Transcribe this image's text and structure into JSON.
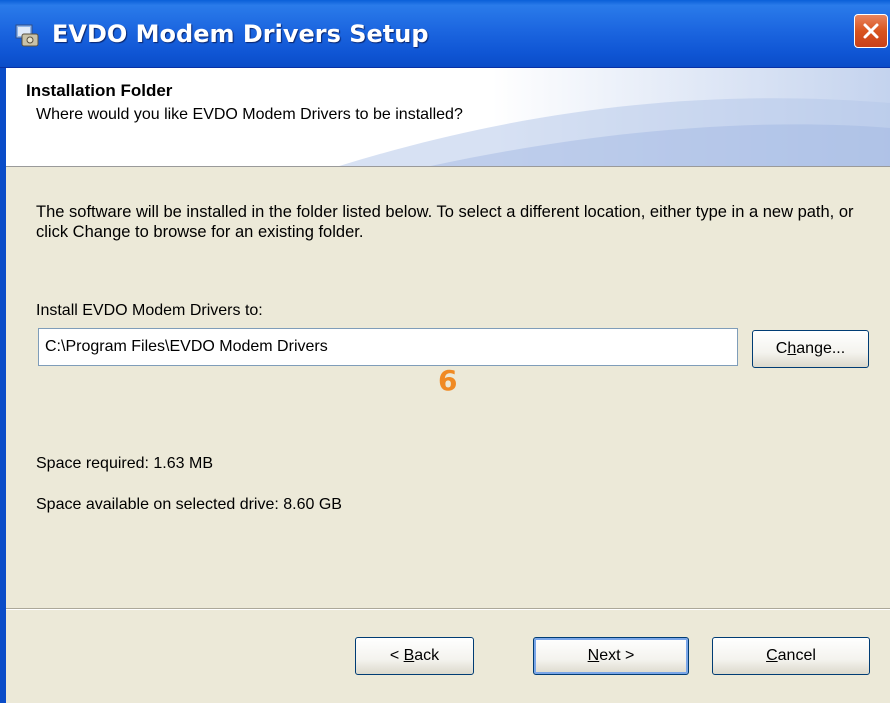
{
  "window": {
    "title": "EVDO Modem Drivers Setup",
    "icon": "setup-app-icon",
    "close_icon": "close-x-icon"
  },
  "header": {
    "title": "Installation Folder",
    "subtitle": "Where would you like EVDO Modem Drivers to be installed?"
  },
  "body": {
    "description": "The software will be installed in the folder listed below. To select a different location, either type in a new path, or click Change to browse for an existing folder.",
    "install_label": "Install EVDO Modem Drivers to:",
    "install_path": "C:\\Program Files\\EVDO Modem Drivers",
    "change_button": {
      "prefix": "C",
      "accel": "h",
      "suffix": "ange..."
    },
    "step_marker": "6",
    "space_required": "Space required: 1.63 MB",
    "space_available": "Space available on selected drive: 8.60 GB"
  },
  "footer": {
    "back_button": {
      "prefix": "< ",
      "accel": "B",
      "suffix": "ack"
    },
    "next_button": {
      "prefix": "",
      "accel": "N",
      "suffix": "ext >"
    },
    "cancel_button": {
      "prefix": "",
      "accel": "C",
      "suffix": "ancel"
    }
  },
  "colors": {
    "titlebar": "#0a4cc8",
    "dialog_bg": "#ece9d8",
    "close_button": "#d9541f",
    "step_marker": "#f08a24"
  }
}
